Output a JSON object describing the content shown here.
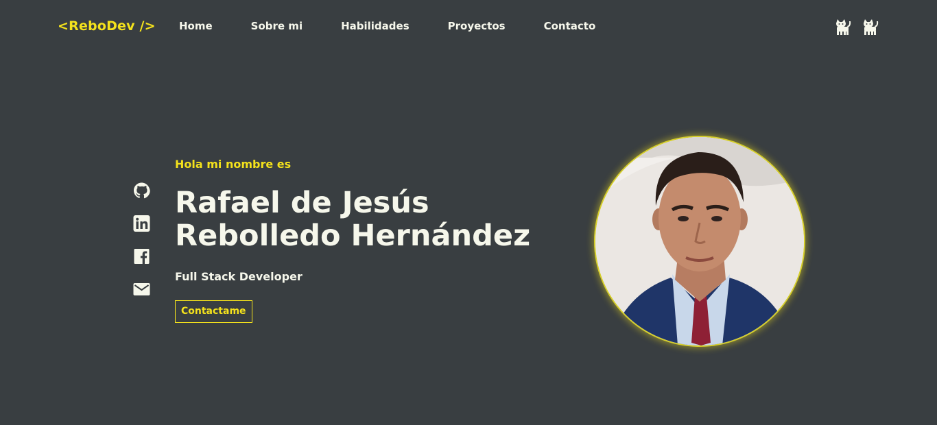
{
  "header": {
    "logo": "<ReboDev />",
    "nav": [
      {
        "label": "Home"
      },
      {
        "label": "Sobre mi"
      },
      {
        "label": "Habilidades"
      },
      {
        "label": "Proyectos"
      },
      {
        "label": "Contacto"
      }
    ],
    "theme_icons": [
      "cat-icon",
      "cat-icon"
    ]
  },
  "social": {
    "icons": [
      "github-icon",
      "linkedin-icon",
      "facebook-icon",
      "mail-icon"
    ]
  },
  "hero": {
    "greeting": "Hola mi nombre es",
    "name_line1": "Rafael de Jesús",
    "name_line2": "Rebolledo Hernández",
    "role": "Full Stack Developer",
    "cta_label": "Contactame"
  },
  "colors": {
    "background": "#393e41",
    "accent": "#f4e21c",
    "text": "#f6f7eb"
  }
}
